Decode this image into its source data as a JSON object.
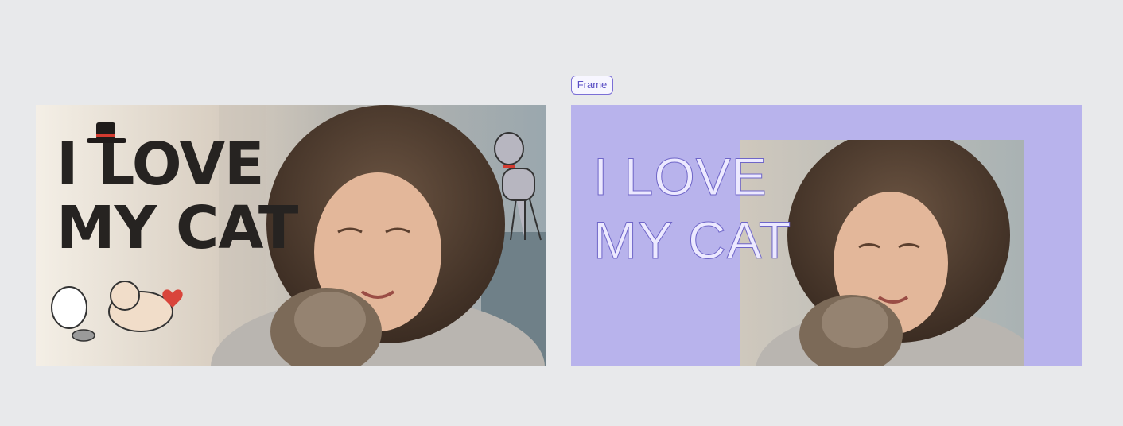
{
  "left_design": {
    "title_line1": "I LOVE",
    "title_line2": "MY CAT",
    "image_alt": "Woman hugging a tabby cat with doodle cats"
  },
  "editor": {
    "frame_label": "Frame",
    "title_line1": "I LOVE",
    "title_line2": "MY CAT",
    "frame_color": "#b8b3ec",
    "accent": "#7b6fd6"
  }
}
